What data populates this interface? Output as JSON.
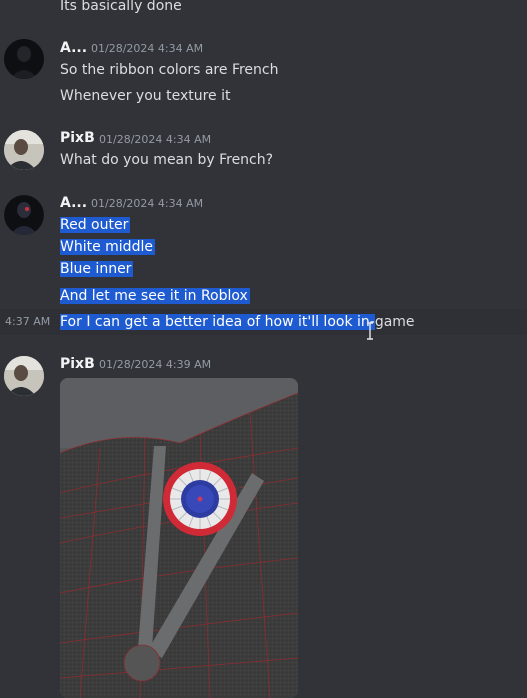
{
  "messages": {
    "top_partial": "Its basically done",
    "group1": {
      "author": "A...",
      "timestamp": "01/28/2024 4:34 AM",
      "lines": [
        "So the ribbon colors are French",
        "Whenever you texture it"
      ]
    },
    "group2": {
      "author": "PixB",
      "timestamp": "01/28/2024 4:34 AM",
      "lines": [
        "What do you mean by French?"
      ]
    },
    "group3": {
      "author": "A...",
      "timestamp": "01/28/2024 4:34 AM",
      "lines": [
        "Red outer",
        "White middle",
        "Blue inner",
        "And let me see it in Roblox"
      ],
      "last_line": {
        "hover_time": "4:37 AM",
        "selected_part": "For I can get a better idea of how it'll look in-",
        "rest": "game"
      }
    },
    "group4": {
      "author": "PixB",
      "timestamp": "01/28/2024 4:39 AM"
    }
  },
  "icons": {
    "cursor": "text-cursor-icon",
    "attachment": "image-attachment"
  },
  "colors": {
    "background": "#313338",
    "selection": "#1f5bd0",
    "username": "#f2f3f5",
    "timestamp": "#949ba4"
  }
}
